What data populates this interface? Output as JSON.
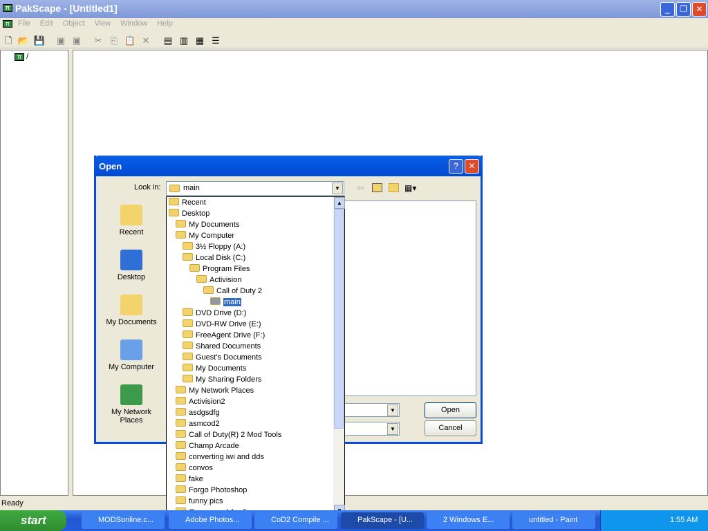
{
  "window": {
    "title": "PakScape - [Untitled1]",
    "status": "Ready"
  },
  "menu": [
    "File",
    "Edit",
    "Object",
    "View",
    "Window",
    "Help"
  ],
  "tree": {
    "root": "/"
  },
  "dialog": {
    "title": "Open",
    "lookin_label": "Look in:",
    "lookin_value": "main",
    "places": [
      "Recent",
      "Desktop",
      "My Documents",
      "My Computer",
      "My Network Places"
    ],
    "open_label": "Open",
    "cancel_label": "Cancel",
    "dropdown": [
      {
        "label": "Recent",
        "level": 0
      },
      {
        "label": "Desktop",
        "level": 0
      },
      {
        "label": "My Documents",
        "level": 1
      },
      {
        "label": "My Computer",
        "level": 1
      },
      {
        "label": "3½ Floppy (A:)",
        "level": 2
      },
      {
        "label": "Local Disk (C:)",
        "level": 2
      },
      {
        "label": "Program Files",
        "level": 3
      },
      {
        "label": "Activision",
        "level": 4
      },
      {
        "label": "Call of Duty 2",
        "level": 5
      },
      {
        "label": "main",
        "level": 6,
        "selected": true
      },
      {
        "label": "DVD Drive (D:)",
        "level": 2
      },
      {
        "label": "DVD-RW Drive (E:)",
        "level": 2
      },
      {
        "label": "FreeAgent Drive (F:)",
        "level": 2
      },
      {
        "label": "Shared Documents",
        "level": 2
      },
      {
        "label": "Guest's Documents",
        "level": 2
      },
      {
        "label": "My Documents",
        "level": 2
      },
      {
        "label": "My Sharing Folders",
        "level": 2
      },
      {
        "label": "My Network Places",
        "level": 1
      },
      {
        "label": "Activision2",
        "level": 1
      },
      {
        "label": "asdgsdfg",
        "level": 1
      },
      {
        "label": "asmcod2",
        "level": 1
      },
      {
        "label": "Call of Duty(R) 2 Mod Tools",
        "level": 1
      },
      {
        "label": "Champ Arcade",
        "level": 1
      },
      {
        "label": "converting iwi and dds",
        "level": 1
      },
      {
        "label": "convos",
        "level": 1
      },
      {
        "label": "fake",
        "level": 1
      },
      {
        "label": "Forgo Photoshop",
        "level": 1
      },
      {
        "label": "funny pics",
        "level": 1
      },
      {
        "label": "Games and Appliances",
        "level": 1
      }
    ]
  },
  "taskbar": {
    "start": "start",
    "tasks": [
      "MODSonline.c...",
      "Adobe Photos...",
      "CoD2 Compile ...",
      "PakScape - [U...",
      "2 Windows E...",
      "untitled - Paint"
    ],
    "active": 3,
    "clock": "1:55 AM"
  },
  "colors": {
    "titlebar": "#0a5fe8",
    "selection": "#316ac5",
    "taskbar": "#245ddb",
    "start": "#3fa93f"
  }
}
